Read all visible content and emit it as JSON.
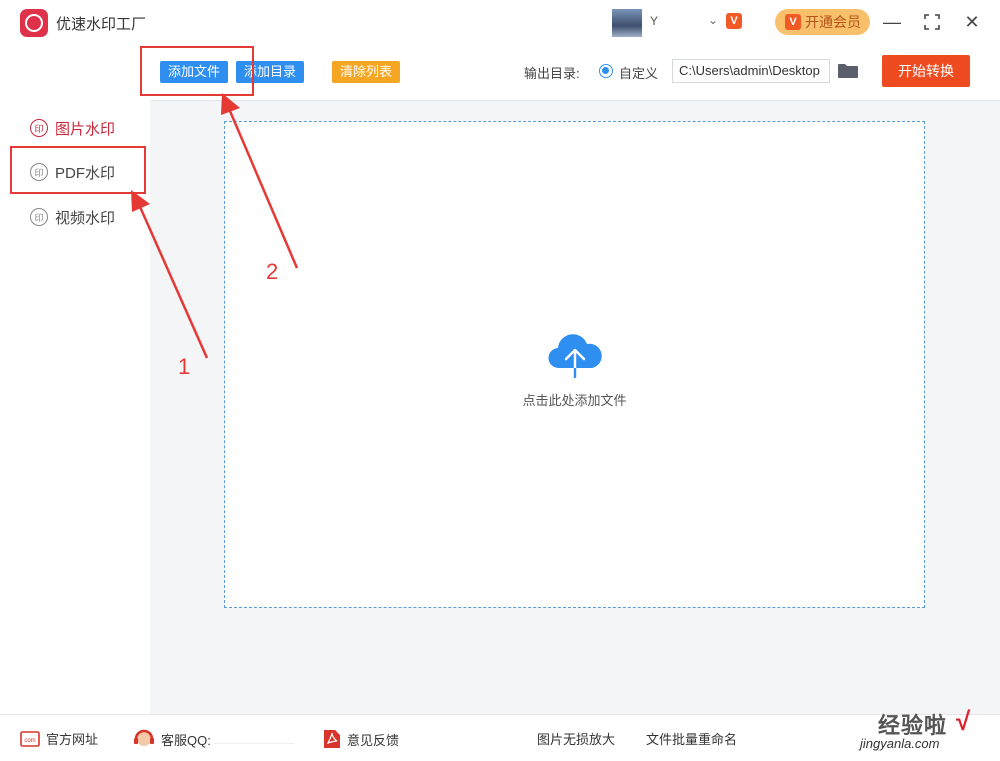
{
  "app": {
    "title": "优速水印工厂",
    "logo_glyph": "印"
  },
  "user": {
    "name": "Y",
    "vip_badge": "V",
    "vip_button_label": "开通会员"
  },
  "window_controls": {
    "minimize": "—",
    "maximize": "⛶",
    "close": "✕"
  },
  "sidebar": {
    "items": [
      {
        "label": "图片水印",
        "icon": "stamp-icon",
        "active": true
      },
      {
        "label": "PDF水印",
        "icon": "stamp-icon",
        "active": false
      },
      {
        "label": "视频水印",
        "icon": "stamp-icon",
        "active": false
      }
    ],
    "stamp_glyph": "印"
  },
  "toolbar": {
    "add_file": "添加文件",
    "add_dir": "添加目录",
    "clear_list": "清除列表",
    "output_label": "输出目录:",
    "custom_option": "自定义",
    "output_path": "C:\\Users\\admin\\Desktop",
    "start_label": "开始转换"
  },
  "dropzone": {
    "text": "点击此处添加文件",
    "icon": "cloud-upload-icon"
  },
  "footer": {
    "website": "官方网址",
    "support_qq": "客服QQ:",
    "feedback": "意见反馈",
    "lossless_enlarge": "图片无损放大",
    "batch_rename": "文件批量重命名"
  },
  "annotations": {
    "one": "1",
    "two": "2"
  },
  "watermark": {
    "brand": "经验啦",
    "domain": "jingyanla.com",
    "check": "√"
  },
  "colors": {
    "accent_blue": "#2f8ff0",
    "accent_orange": "#f6a623",
    "start_red": "#ee4b20",
    "active_red": "#c8283b",
    "annotation_red": "#e53935"
  }
}
